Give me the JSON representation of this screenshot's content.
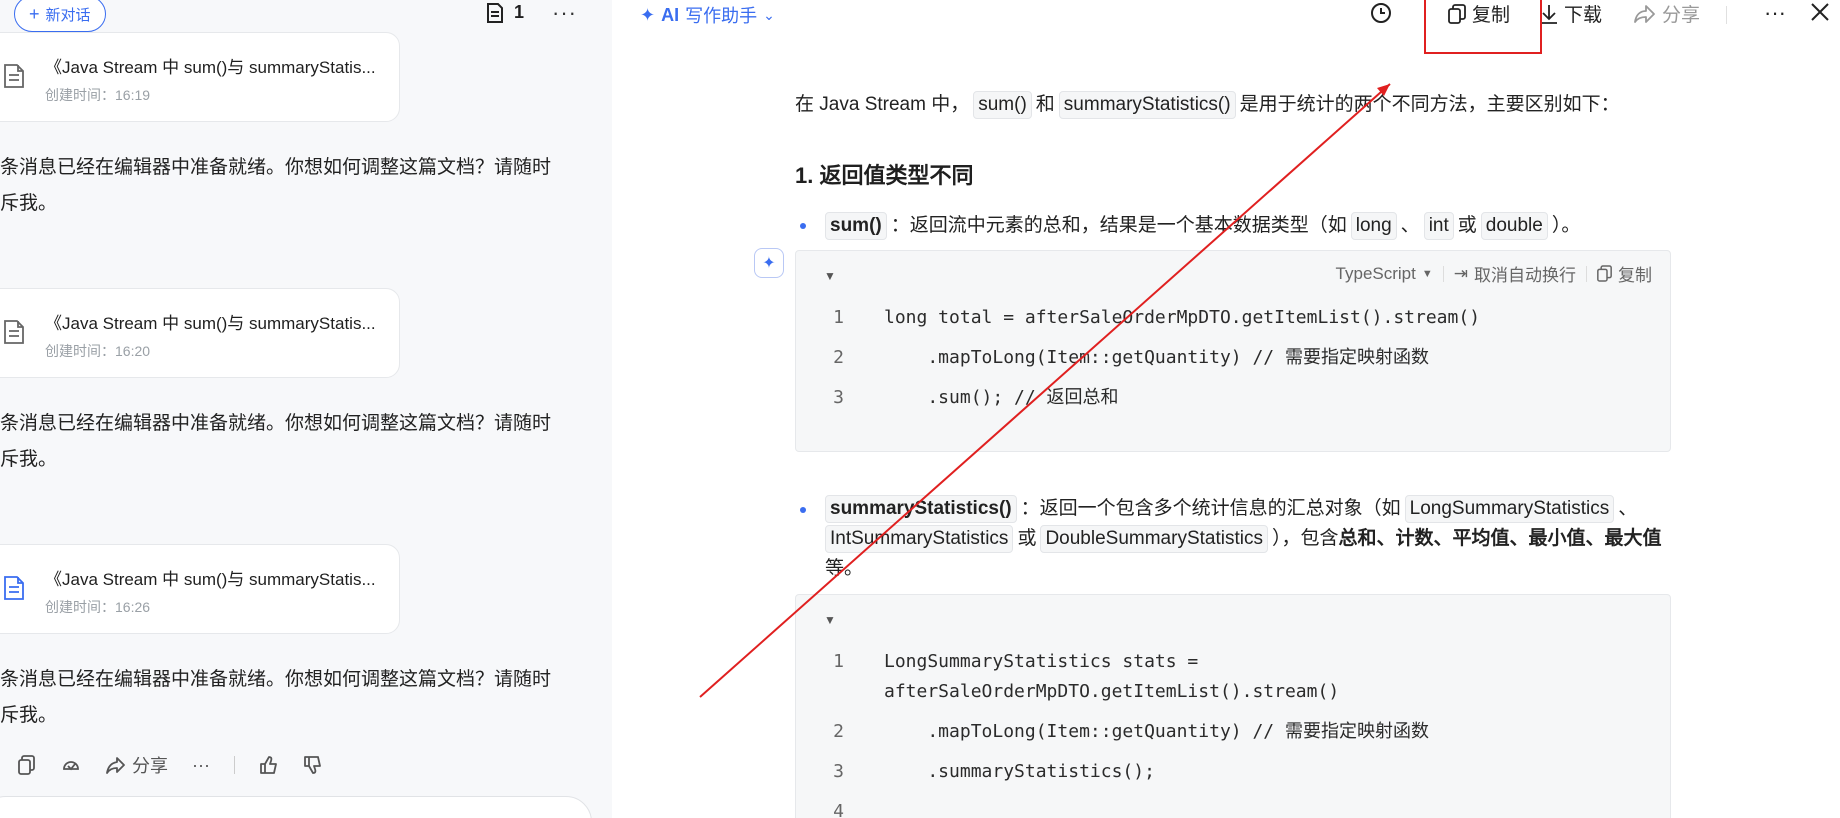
{
  "left": {
    "new_chat": "新对话",
    "doc_count": "1",
    "more": "···",
    "cards": [
      {
        "title": "《Java Stream 中 sum()与 summaryStatis...",
        "time": "创建时间：16:19"
      },
      {
        "title": "《Java Stream 中 sum()与 summaryStatis...",
        "time": "创建时间：16:20"
      },
      {
        "title": "《Java Stream 中 sum()与 summaryStatis...",
        "time": "创建时间：16:26"
      }
    ],
    "messages": [
      {
        "line1": "条消息已经在编辑器中准备就绪。你想如何调整这篇文档？请随时",
        "line2": "斥我。"
      },
      {
        "line1": "条消息已经在编辑器中准备就绪。你想如何调整这篇文档？请随时",
        "line2": "斥我。"
      },
      {
        "line1": "条消息已经在编辑器中准备就绪。你想如何调整这篇文档？请随时",
        "line2": "斥我。"
      }
    ],
    "actions": {
      "share": "分享",
      "more": "···"
    }
  },
  "right": {
    "toolbar": {
      "ai_label": "AI",
      "assistant": "写作助手",
      "copy": "复制",
      "download": "下载",
      "share": "分享",
      "more": "···"
    },
    "intro": {
      "p1": "在 Java Stream 中，",
      "c1": "sum()",
      "p2": "和",
      "c2": "summaryStatistics()",
      "p3": "是用于统计的两个不同方法，主要区别如下："
    },
    "heading": "1. 返回值类型不同",
    "bullet1": {
      "name": "sum()",
      "text1": "：返回流中元素的总和，结果是一个基本数据类型（如",
      "t1": "long",
      "sep1": "、",
      "t2": "int",
      "or": "或",
      "t3": "double",
      "end": "）。"
    },
    "code1": {
      "lang": "TypeScript",
      "wrap": "取消自动换行",
      "copy": "复制",
      "lines": [
        {
          "n": "1",
          "code": "long total = afterSaleOrderMpDTO.getItemList().stream()"
        },
        {
          "n": "2",
          "code": "    .mapToLong(Item::getQuantity) // 需要指定映射函数"
        },
        {
          "n": "3",
          "code": "    .sum(); // 返回总和"
        }
      ]
    },
    "bullet2": {
      "name": "summaryStatistics()",
      "text1": "：返回一个包含多个统计信息的汇总对象（如",
      "t1": "LongSummaryStatistics",
      "sep1": "、",
      "t2": "IntSummaryStatistics",
      "or": "或",
      "t3": "DoubleSummaryStatistics",
      "text2": "），包含",
      "bold": "总和、计数、平均值、最小值、最",
      "bold2": "大值",
      "end": "等。"
    },
    "code2": {
      "lines": [
        {
          "n": "1",
          "code": "LongSummaryStatistics stats ="
        },
        {
          "n": "",
          "code": "afterSaleOrderMpDTO.getItemList().stream()"
        },
        {
          "n": "2",
          "code": "    .mapToLong(Item::getQuantity) // 需要指定映射函数"
        },
        {
          "n": "3",
          "code": "    .summaryStatistics();"
        },
        {
          "n": "4",
          "code": ""
        }
      ]
    }
  }
}
